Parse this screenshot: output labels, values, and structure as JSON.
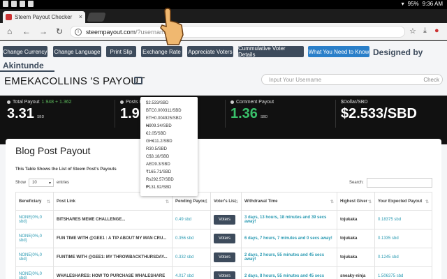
{
  "statusbar": {
    "left_icons": [
      "gallery-icon",
      "mail-icon",
      "notification-icon",
      "app-icon"
    ],
    "battery": "95%",
    "time": "9:36 AM"
  },
  "browser": {
    "tab_title": "Steem Payout Checker",
    "close_glyph": "×",
    "url_host": "steempayout.com",
    "url_path": "/?username=em",
    "nav": {
      "home": "⌂",
      "back": "←",
      "forward": "→",
      "reload": "↻"
    }
  },
  "nav_buttons": [
    "Change Currency",
    "Change Language",
    "Print Slip",
    "Exchange Rate",
    "Appreciate Voters",
    "Cummulative Voter Details",
    "What You Need to Know"
  ],
  "designed_by": "Designed by",
  "author": "Akintunde",
  "payout_title": "EMEKACOLLINS 'S PAYOUT",
  "username_input": {
    "placeholder": "Input Your Username",
    "check": "Check"
  },
  "stats": {
    "total": {
      "label": "Total Payout",
      "sub": "1.948 + 1.362",
      "value": "3.31",
      "unit": "SBD"
    },
    "posts": {
      "label": "Posts Pay",
      "value": "1.9"
    },
    "comment": {
      "label": "Comment Payout",
      "value": "1.36",
      "unit": "SBD"
    },
    "dollar": {
      "label": "$Dollar/SBD",
      "value": "$2.533/SBD"
    }
  },
  "exchange_rates": [
    "$2.533/SBD",
    "BTC0.000311/SBD",
    "ETH0.004925/SBD",
    "₦909.34/SBD",
    "€2.05/SBD",
    "GH€11.2/SBD",
    "R30.5/SBD",
    "C$3.18/SBD",
    "AED9.3/SBD",
    "₹165.71/SBD",
    "Rs292.57/SBD",
    "₱131.92/SBD"
  ],
  "blog": {
    "title": "Blog Post Payout",
    "subtitle": "This Table Shows the List of Steem Post's Payouts",
    "show_label": "Show",
    "show_value": "10",
    "entries_label": "entries",
    "search_label": "Search:",
    "columns": [
      "Beneficiary",
      "Post Link",
      "Pending Payout",
      "Voter's List",
      "Withdrawal Time",
      "Highest Giver",
      "Your Expected Payout"
    ],
    "rows": [
      {
        "beneficiary": "NONE(0%,0 sbd)",
        "post": "BITSHARES MEME CHALLENGE...",
        "pending": "0.49 sbd",
        "voters": "Voters",
        "withdrawal": "3 days, 13 hours, 18 minutes and 39 secs away!",
        "giver": "tojukaka",
        "expected": "0.18375 sbd"
      },
      {
        "beneficiary": "NONE(0%,0 sbd)",
        "post": "FUN TIME WITH @GEE1 : A TIP ABOUT MY MAN CRU...",
        "pending": "0.356 sbd",
        "voters": "Voters",
        "withdrawal": "6 days, 7 hours, 7 minutes and 0 secs away!",
        "giver": "tojukaka",
        "expected": "0.1335 sbd"
      },
      {
        "beneficiary": "NONE(0%,0 sbd)",
        "post": "FUNTIME WITH @GEE1: MY THROWBACKTHURSDAY...",
        "pending": "0.332 sbd",
        "voters": "Voters",
        "withdrawal": "2 days, 2 hours, 55 minutes and 45 secs away!",
        "giver": "tojukaka",
        "expected": "0.1245 sbd"
      },
      {
        "beneficiary": "NONE(0%,0 sbd)",
        "post": "WHALESHARES: HOW TO PURCHASE WHALESHARE",
        "pending": "4.017 sbd",
        "voters": "Voters",
        "withdrawal": "2 days, 8 hours, 55 minutes and 45 secs",
        "giver": "sneaky-ninja",
        "expected": "1.506375 sbd"
      }
    ]
  },
  "colors": {
    "button": "#3d4b5c",
    "button_highlight": "#2a7fc9",
    "stats_bg": "#111111",
    "accent_green": "#39c06a",
    "link_teal": "#2a9ab2"
  }
}
